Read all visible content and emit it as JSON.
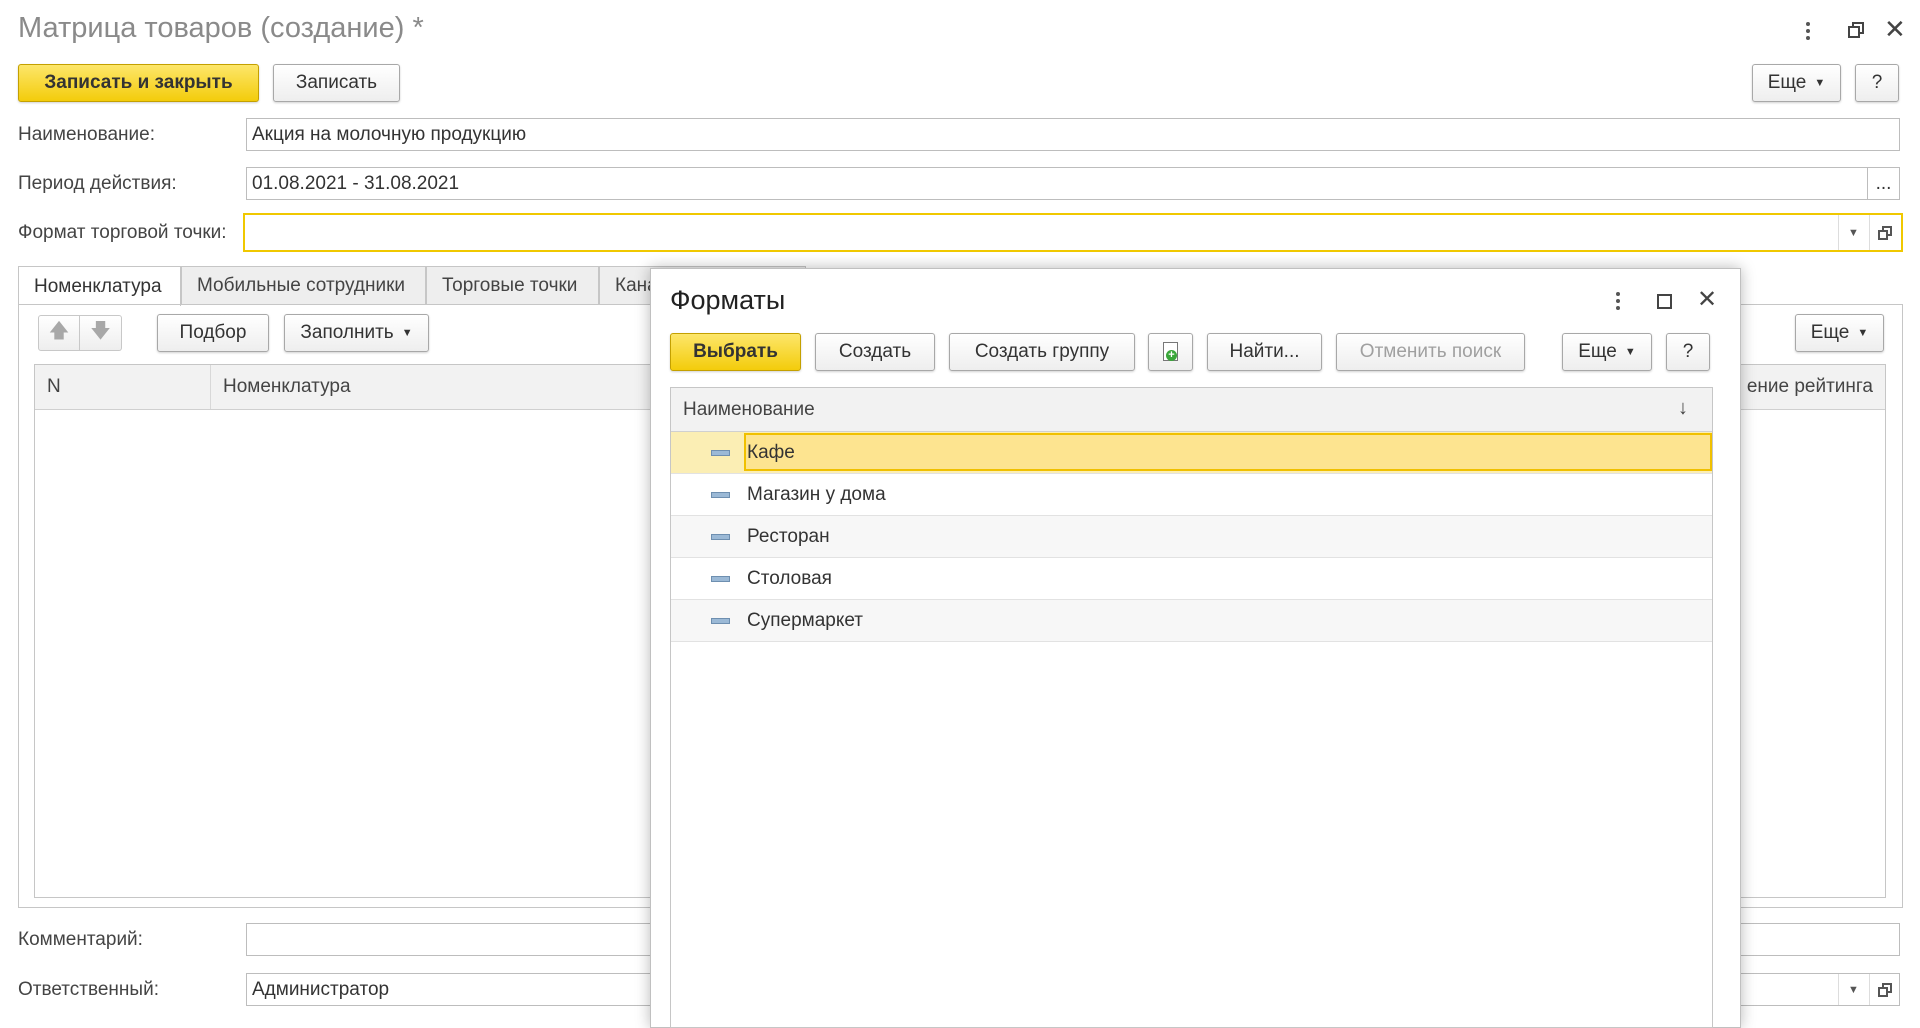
{
  "window": {
    "title": "Матрица товаров (создание) *"
  },
  "toolbar": {
    "save_close": "Записать и закрыть",
    "save": "Записать",
    "more": "Еще",
    "help": "?"
  },
  "form": {
    "name_label": "Наименование:",
    "name_value": "Акция на молочную продукцию",
    "period_label": "Период действия:",
    "period_value": "01.08.2021 - 31.08.2021",
    "period_btn": "...",
    "format_label": "Формат торговой точки:",
    "format_value": "",
    "comment_label": "Комментарий:",
    "comment_value": "",
    "responsible_label": "Ответственный:",
    "responsible_value": "Администратор"
  },
  "tabs": [
    {
      "label": "Номенклатура"
    },
    {
      "label": "Мобильные сотрудники"
    },
    {
      "label": "Торговые точки"
    },
    {
      "label": "Кана"
    }
  ],
  "table_toolbar": {
    "pick": "Подбор",
    "fill": "Заполнить",
    "more": "Еще"
  },
  "table": {
    "col_n": "N",
    "col_nomenclature": "Номенклатура",
    "col_rating_fragment": "ение рейтинга"
  },
  "dialog": {
    "title": "Форматы",
    "select": "Выбрать",
    "create": "Создать",
    "create_group": "Создать группу",
    "find": "Найти...",
    "cancel_search": "Отменить поиск",
    "more": "Еще",
    "help": "?",
    "column_header": "Наименование",
    "sort_indicator": "↓",
    "items": [
      {
        "label": "Кафе",
        "selected": true
      },
      {
        "label": "Магазин у дома",
        "selected": false
      },
      {
        "label": "Ресторан",
        "selected": false
      },
      {
        "label": "Столовая",
        "selected": false
      },
      {
        "label": "Супермаркет",
        "selected": false
      }
    ]
  },
  "colors": {
    "accent_yellow": "#f5cf1a",
    "selected_row": "#fbeeb4",
    "selected_cell": "#fde490",
    "focus_border": "#f0c800"
  }
}
